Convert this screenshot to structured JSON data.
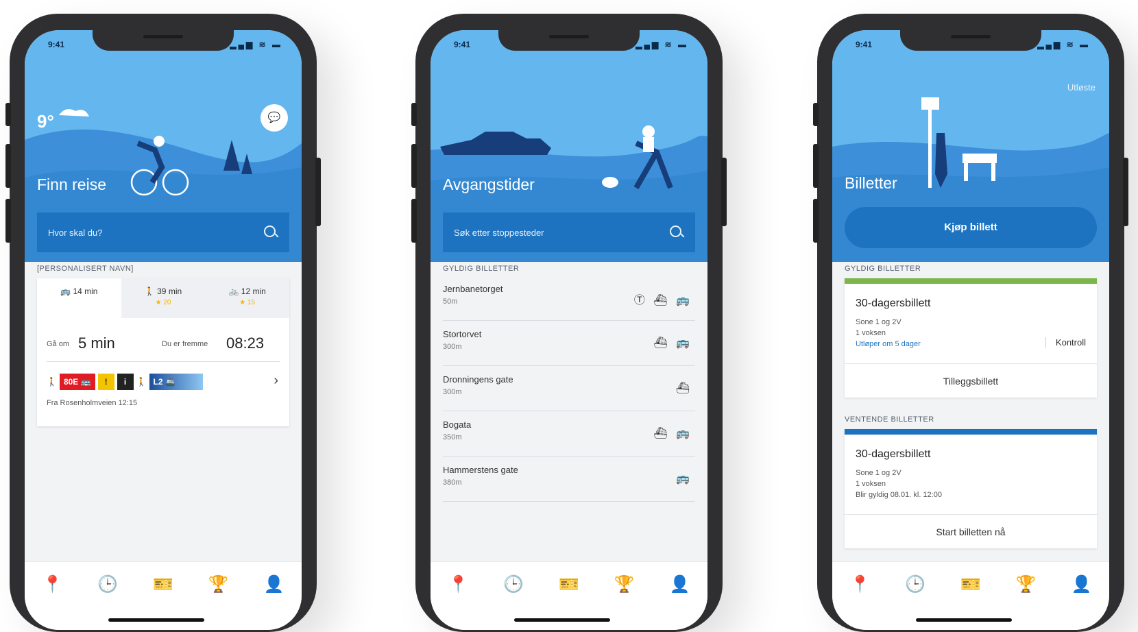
{
  "status": {
    "time": "9:41",
    "icons": "▂▄▆ ≋ ▬"
  },
  "screen1": {
    "weather": "9°",
    "weather_icon": "cloud-icon",
    "chat_icon": "💬",
    "title": "Finn reise",
    "search_placeholder": "Hvor skal du?",
    "section_label": "[PERSONALISERT NAVN]",
    "modes": [
      {
        "label": "🚌 14 min",
        "sub": ""
      },
      {
        "label": "🚶 39 min",
        "sub": "★ 20"
      },
      {
        "label": "🚲 12 min",
        "sub": "★ 15"
      }
    ],
    "depart_label": "Gå om",
    "depart_value": "5 min",
    "arrive_label": "Du er fremme",
    "arrive_value": "08:23",
    "leg_walk1": "🚶",
    "leg_bus": "80E 🚌",
    "leg_warn": "!",
    "leg_info": "i",
    "leg_walk2": "🚶",
    "leg_boat": "L2 🚢",
    "from_text": "Fra Rosenholmveien 12:15",
    "chevron": "›"
  },
  "screen2": {
    "title": "Avgangstider",
    "search_placeholder": "Søk etter stoppesteder",
    "section_label": "GYLDIG BILLETTER",
    "stops": [
      {
        "name": "Jernbanetorget",
        "dist": "50m",
        "icons": "Ⓣ ⛴ 🚌"
      },
      {
        "name": "Stortorvet",
        "dist": "300m",
        "icons": "⛴ 🚌"
      },
      {
        "name": "Dronningens gate",
        "dist": "300m",
        "icons": "⛴"
      },
      {
        "name": "Bogata",
        "dist": "350m",
        "icons": "⛴ 🚌"
      },
      {
        "name": "Hammerstens gate",
        "dist": "380m",
        "icons": "🚌"
      }
    ]
  },
  "screen3": {
    "upper_link": "Utløste",
    "title": "Billetter",
    "buy_label": "Kjøp billett",
    "section_valid": "GYLDIG BILLETTER",
    "section_pending": "VENTENDE BILLETTER",
    "ticket1": {
      "name": "30-dagersbillett",
      "line1": "Sone 1 og 2V",
      "line2": "1 voksen",
      "link": "Utløper om 5 dager",
      "kontroll": "Kontroll",
      "action": "Tilleggsbillett",
      "bar_color": "#7ab648"
    },
    "ticket2": {
      "name": "30-dagersbillett",
      "line1": "Sone 1 og 2V",
      "line2": "1 voksen",
      "line3": "Blir gyldig 08.01. kl. 12:00",
      "action": "Start billetten nå",
      "bar_color": "#1d73c0"
    }
  },
  "tabs": [
    {
      "name": "tab-travel",
      "icon": "📍"
    },
    {
      "name": "tab-departures",
      "icon": "🕒"
    },
    {
      "name": "tab-tickets",
      "icon": "🎫"
    },
    {
      "name": "tab-achievements",
      "icon": "🏆"
    },
    {
      "name": "tab-profile",
      "icon": "👤"
    }
  ],
  "colors": {
    "sky": "#64b6ef",
    "brand": "#1d73c0",
    "hill": "#3c8fd8"
  }
}
